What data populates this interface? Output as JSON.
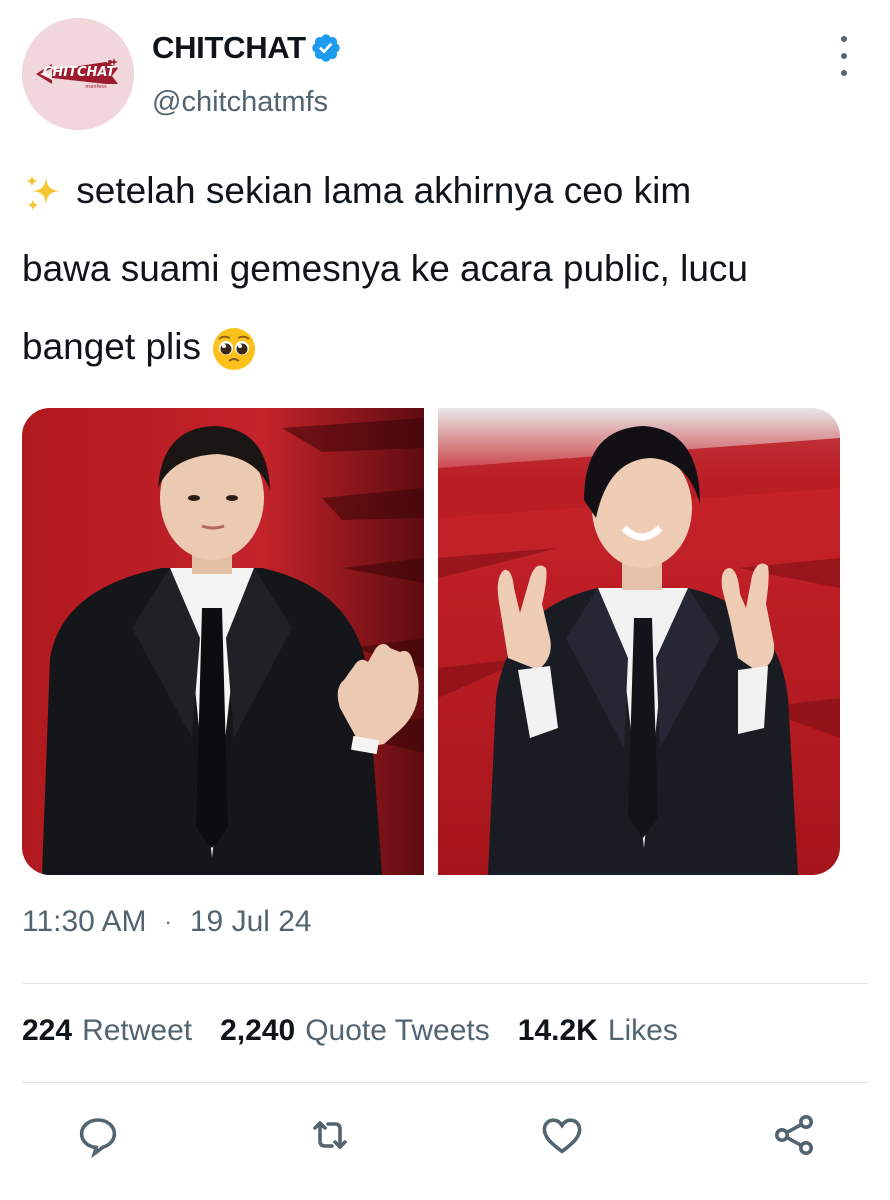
{
  "author": {
    "display_name": "CHITCHAT",
    "handle": "@chitchatmfs",
    "avatar_logo_text": "CHITCHAT",
    "avatar_logo_subtext": "menfess",
    "verified_icon": "verified-badge-icon",
    "accent_color": "#1d9bf0"
  },
  "tweet": {
    "lead_emoji": "sparkles-emoji",
    "line1": "setelah sekian lama akhirnya ceo kim",
    "line2": "bawa suami gemesnya ke acara public, lucu",
    "line3": "banget plis",
    "trail_emoji": "pleading-face-emoji"
  },
  "media": [
    {
      "kind": "photo",
      "description_icon": "photo-man-waving"
    },
    {
      "kind": "photo",
      "description_icon": "photo-man-peace-signs"
    }
  ],
  "meta": {
    "time": "11:30 AM",
    "separator": "·",
    "date": "19 Jul 24"
  },
  "stats": {
    "retweets_count": "224",
    "retweets_label": "Retweet",
    "quotes_count": "2,240",
    "quotes_label": "Quote Tweets",
    "likes_count": "14.2K",
    "likes_label": "Likes"
  },
  "actions": {
    "reply_icon": "reply-icon",
    "retweet_icon": "retweet-icon",
    "like_icon": "heart-icon",
    "share_icon": "share-icon"
  },
  "colors": {
    "text_primary": "#0f1419",
    "text_secondary": "#536471",
    "divider": "#dfe3e6"
  }
}
